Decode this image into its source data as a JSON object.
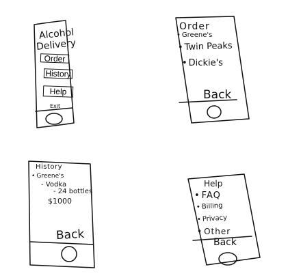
{
  "screens": {
    "home": {
      "title_line1": "Alcohol",
      "title_line2": "Delivery",
      "buttons": [
        "Order",
        "History",
        "Help"
      ],
      "exit_label": "Exit"
    },
    "order": {
      "title": "Order",
      "items": [
        "Greene's",
        "Twin Peaks",
        "Dickie's"
      ],
      "back_label": "Back"
    },
    "history": {
      "title": "History",
      "store": "Greene's",
      "item": "Vodka",
      "detail": "24 bottles",
      "amount": "$1000",
      "back_label": "Back"
    },
    "help": {
      "title": "Help",
      "items": [
        "FAQ",
        "Billing",
        "Privacy",
        "Other"
      ],
      "back_label": "Back"
    }
  }
}
